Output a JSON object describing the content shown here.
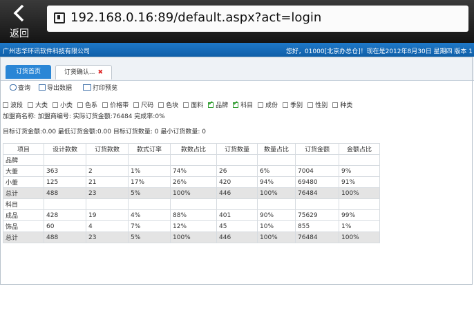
{
  "browser": {
    "back_label": "返回",
    "url": "192.168.0.16:89/default.aspx?act=login"
  },
  "brand": {
    "company": "广州志华环讯软件科技有限公司",
    "info": "您好，01000[北京办总仓]！现在是2012年8月30日 星期四 版本 1"
  },
  "tabs": [
    {
      "label": "订货首页"
    },
    {
      "label": "订货确认..."
    }
  ],
  "toolbar": {
    "query_label": "查询",
    "export_label": "导出数据",
    "print_label": "打印预览"
  },
  "filters": [
    {
      "label": "波段",
      "checked": false
    },
    {
      "label": "大类",
      "checked": false
    },
    {
      "label": "小类",
      "checked": false
    },
    {
      "label": "色系",
      "checked": false
    },
    {
      "label": "价格带",
      "checked": false
    },
    {
      "label": "尺码",
      "checked": false
    },
    {
      "label": "色块",
      "checked": false
    },
    {
      "label": "面料",
      "checked": false
    },
    {
      "label": "品牌",
      "checked": true
    },
    {
      "label": "科目",
      "checked": true
    },
    {
      "label": "成份",
      "checked": false
    },
    {
      "label": "季别",
      "checked": false
    },
    {
      "label": "性别",
      "checked": false
    },
    {
      "label": "种类",
      "checked": false
    }
  ],
  "summary": {
    "line1": "加盟商名称: 加盟商编号: 实际订货金额:76484 完成率:0%",
    "line2": "目标订货金额:0.00 最低订货金额:0.00 目标订货数量: 0 最小订货数量: 0"
  },
  "table": {
    "headers": [
      "项目",
      "设计款数",
      "订货款数",
      "款式订率",
      "款数占比",
      "订货数量",
      "数量占比",
      "订货金额",
      "金额占比"
    ],
    "rows": [
      {
        "kind": "group",
        "cells": [
          "品牌",
          "",
          "",
          "",
          "",
          "",
          "",
          "",
          ""
        ]
      },
      {
        "kind": "data",
        "cells": [
          "大董",
          "363",
          "2",
          "1%",
          "74%",
          "26",
          "6%",
          "7004",
          "9%"
        ]
      },
      {
        "kind": "data",
        "cells": [
          "小董",
          "125",
          "21",
          "17%",
          "26%",
          "420",
          "94%",
          "69480",
          "91%"
        ]
      },
      {
        "kind": "total",
        "cells": [
          "总计",
          "488",
          "23",
          "5%",
          "100%",
          "446",
          "100%",
          "76484",
          "100%"
        ]
      },
      {
        "kind": "group",
        "cells": [
          "科目",
          "",
          "",
          "",
          "",
          "",
          "",
          "",
          ""
        ]
      },
      {
        "kind": "data",
        "cells": [
          "成品",
          "428",
          "19",
          "4%",
          "88%",
          "401",
          "90%",
          "75629",
          "99%"
        ]
      },
      {
        "kind": "data",
        "cells": [
          "饰品",
          "60",
          "4",
          "7%",
          "12%",
          "45",
          "10%",
          "855",
          "1%"
        ]
      },
      {
        "kind": "total",
        "cells": [
          "总计",
          "488",
          "23",
          "5%",
          "100%",
          "446",
          "100%",
          "76484",
          "100%"
        ]
      }
    ]
  },
  "colors": {
    "brand_bar": "#1565b5",
    "active_tab": "#2a86d6",
    "close_x": "#dd2222",
    "check": "#2a9a2a"
  }
}
